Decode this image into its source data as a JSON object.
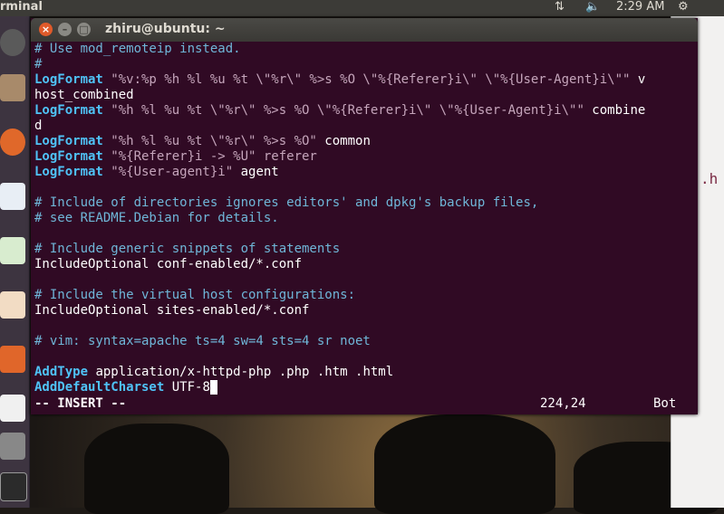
{
  "top_panel": {
    "app_title": "rminal",
    "time": "2:29 AM"
  },
  "terminal": {
    "title": "zhiru@ubuntu: ~",
    "lines": [
      [
        {
          "t": "# Use mod_remoteip instead.",
          "c": "cm"
        }
      ],
      [
        {
          "t": "#",
          "c": "cm"
        }
      ],
      [
        {
          "t": "LogFormat",
          "c": "kw"
        },
        {
          "t": " \"%v:%p %h %l %u %t \\\"%r\\\" %>s %O \\\"%{Referer}i\\\" \\\"%{User-Agent}i\\\"\"",
          "c": "st"
        },
        {
          "t": " v",
          "c": "tx"
        }
      ],
      [
        {
          "t": "host_combined",
          "c": "tx"
        }
      ],
      [
        {
          "t": "LogFormat",
          "c": "kw"
        },
        {
          "t": " \"%h %l %u %t \\\"%r\\\" %>s %O \\\"%{Referer}i\\\" \\\"%{User-Agent}i\\\"\"",
          "c": "st"
        },
        {
          "t": " combine",
          "c": "tx"
        }
      ],
      [
        {
          "t": "d",
          "c": "tx"
        }
      ],
      [
        {
          "t": "LogFormat",
          "c": "kw"
        },
        {
          "t": " \"%h %l %u %t \\\"%r\\\" %>s %O\"",
          "c": "st"
        },
        {
          "t": " common",
          "c": "tx"
        }
      ],
      [
        {
          "t": "LogFormat",
          "c": "kw"
        },
        {
          "t": " \"%{Referer}i -> %U\" referer",
          "c": "st"
        }
      ],
      [
        {
          "t": "LogFormat",
          "c": "kw"
        },
        {
          "t": " \"%{User-agent}i\"",
          "c": "st"
        },
        {
          "t": " agent",
          "c": "tx"
        }
      ],
      [],
      [
        {
          "t": "# Include of directories ignores editors' and dpkg's backup files,",
          "c": "cm"
        }
      ],
      [
        {
          "t": "# see README.Debian for details.",
          "c": "cm"
        }
      ],
      [],
      [
        {
          "t": "# Include generic snippets of statements",
          "c": "cm"
        }
      ],
      [
        {
          "t": "IncludeOptional conf-enabled/*.conf",
          "c": "tx"
        }
      ],
      [],
      [
        {
          "t": "# Include the virtual host configurations:",
          "c": "cm"
        }
      ],
      [
        {
          "t": "IncludeOptional sites-enabled/*.conf",
          "c": "tx"
        }
      ],
      [],
      [
        {
          "t": "# vim: syntax=apache ts=4 sw=4 sts=4 sr noet",
          "c": "cm"
        }
      ],
      [],
      [
        {
          "t": "AddType",
          "c": "kw"
        },
        {
          "t": " application/x-httpd-php .php .htm .html",
          "c": "tx"
        }
      ],
      [
        {
          "t": "AddDefaultCharset",
          "c": "kw"
        },
        {
          "t": " UTF-8",
          "c": "tx"
        }
      ]
    ],
    "status": {
      "mode": "-- INSERT --",
      "position": "224,24",
      "scroll": "Bot"
    }
  },
  "background_window": {
    "fragment": ".h"
  },
  "colors": {
    "terminal_bg": "#300a24",
    "comment": "#6fb6d8",
    "keyword": "#4fc3f7",
    "string": "#c5a5bb",
    "close_button": "#e05a2a"
  },
  "launcher_icons": [
    "ubuntu-dash-icon",
    "files-icon",
    "firefox-icon",
    "writer-icon",
    "calc-icon",
    "impress-icon",
    "software-center-icon",
    "amazon-icon",
    "updater-icon",
    "terminal-icon"
  ]
}
